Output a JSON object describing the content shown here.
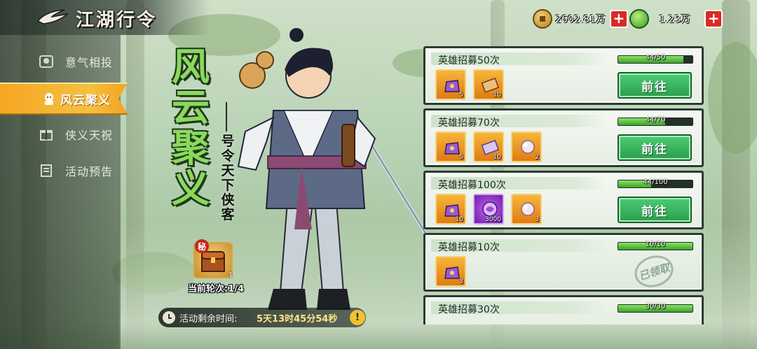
{
  "header": {
    "title": "江湖行令"
  },
  "currency": [
    {
      "icon": "copper-coin-icon",
      "value": "2602.81万"
    },
    {
      "icon": "jade-icon",
      "value": "1.23万"
    }
  ],
  "sidebar": {
    "items": [
      {
        "label": "意气相投",
        "icon": "portrait-icon",
        "active": false
      },
      {
        "label": "风云聚义",
        "icon": "hero-icon",
        "active": true
      },
      {
        "label": "侠义天祝",
        "icon": "gift-icon",
        "active": false
      },
      {
        "label": "活动预告",
        "icon": "scroll-icon",
        "active": false
      }
    ]
  },
  "banner": {
    "big_title": "风云聚义",
    "subtitle": "号令天下侠客",
    "round_badge": "秘",
    "round_count": "1",
    "round_label": "当前轮次:1/4"
  },
  "timer": {
    "label": "活动剩余时间:",
    "value": "5天13时45分54秒",
    "warn": "!"
  },
  "tasks": [
    {
      "title": "英雄招募50次",
      "progress": "44/50",
      "ratio": 0.88,
      "status": "go",
      "button": "前往",
      "rewards": [
        {
          "type": "orange",
          "qty": "5"
        },
        {
          "type": "orange",
          "qty": "10"
        }
      ]
    },
    {
      "title": "英雄招募70次",
      "progress": "44/70",
      "ratio": 0.63,
      "status": "go",
      "button": "前往",
      "rewards": [
        {
          "type": "orange",
          "qty": "5"
        },
        {
          "type": "orange",
          "qty": "10"
        },
        {
          "type": "orange",
          "qty": "2"
        }
      ]
    },
    {
      "title": "英雄招募100次",
      "progress": "44/100",
      "ratio": 0.44,
      "status": "go",
      "button": "前往",
      "rewards": [
        {
          "type": "orange",
          "qty": "10"
        },
        {
          "type": "purple",
          "qty": "3000"
        },
        {
          "type": "orange",
          "qty": "3"
        }
      ]
    },
    {
      "title": "英雄招募10次",
      "progress": "10/10",
      "ratio": 1.0,
      "status": "claimed",
      "button": "已领取",
      "rewards": [
        {
          "type": "orange",
          "qty": "3"
        }
      ]
    },
    {
      "title": "英雄招募30次",
      "progress": "30/30",
      "ratio": 1.0,
      "status": "claimed",
      "button": "",
      "rewards": []
    }
  ],
  "colors": {
    "accent_orange": "#f5a623",
    "progress_green": "#38a52a",
    "button_green": "#2b9e4c",
    "title_green": "#8bd85e"
  }
}
